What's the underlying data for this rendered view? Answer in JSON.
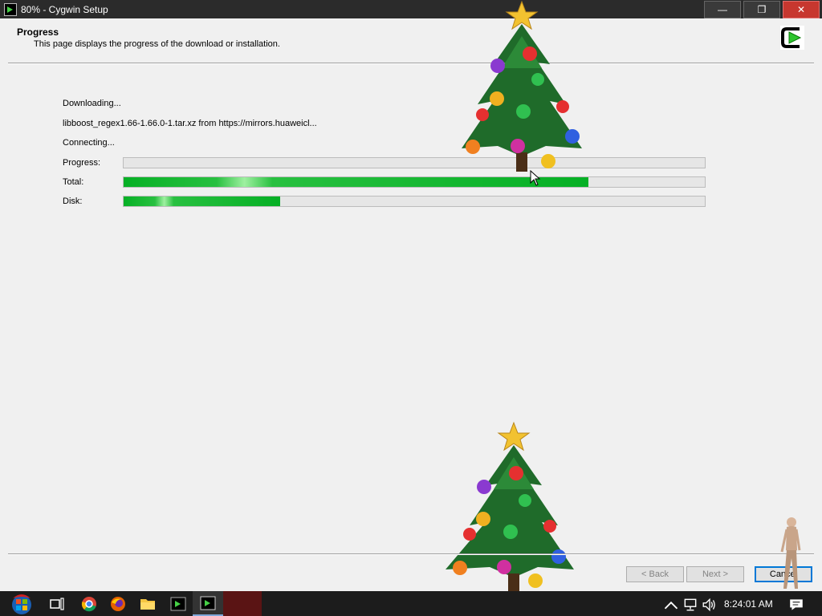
{
  "window": {
    "title": "80% - Cygwin Setup",
    "minimize": "—",
    "maximize": "❐",
    "close": "✕"
  },
  "header": {
    "title": "Progress",
    "description": "This page displays the progress of the download or installation."
  },
  "status": {
    "action": "Downloading...",
    "file": "libboost_regex1.66-1.66.0-1.tar.xz from https://mirrors.huaweicl...",
    "connection": "Connecting..."
  },
  "progress": {
    "labels": {
      "progress": "Progress:",
      "total": "Total:",
      "disk": "Disk:"
    },
    "progress_fraction": 0.0,
    "total_fraction": 0.8,
    "disk_fraction": 0.27
  },
  "buttons": {
    "back": "< Back",
    "next": "Next >",
    "cancel": "Cancel"
  },
  "taskbar": {
    "clock": "8:24:01 AM",
    "icons": [
      "start-icon",
      "task-view-icon",
      "chrome-icon",
      "firefox-icon",
      "file-explorer-icon",
      "cygwin-terminal-icon",
      "cygwin-setup-icon"
    ],
    "tray": [
      "chevron-up-icon",
      "network-icon",
      "volume-icon",
      "notifications-icon"
    ]
  },
  "colors": {
    "progress_fill": "#06b025",
    "titlebar": "#2b2b2b",
    "close": "#c7372f",
    "accent": "#0078d7"
  }
}
